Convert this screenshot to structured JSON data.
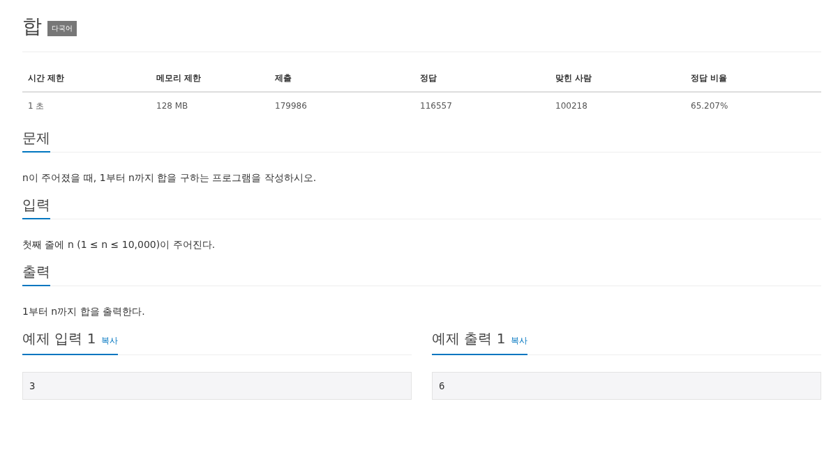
{
  "title": "합",
  "badge": "다국어",
  "stats": {
    "columns": [
      "시간 제한",
      "메모리 제한",
      "제출",
      "정답",
      "맞힌 사람",
      "정답 비율"
    ],
    "values": [
      "1 초",
      "128 MB",
      "179986",
      "116557",
      "100218",
      "65.207%"
    ]
  },
  "sections": [
    {
      "heading": "문제",
      "text": "n이 주어졌을 때, 1부터 n까지 합을 구하는 프로그램을 작성하시오."
    },
    {
      "heading": "입력",
      "text": "첫째 줄에 n (1 ≤ n ≤ 10,000)이 주어진다."
    },
    {
      "heading": "출력",
      "text": "1부터 n까지 합을 출력한다."
    }
  ],
  "samples": [
    {
      "heading": "예제 입력 1",
      "copy": "복사",
      "content": "3"
    },
    {
      "heading": "예제 출력 1",
      "copy": "복사",
      "content": "6"
    }
  ]
}
